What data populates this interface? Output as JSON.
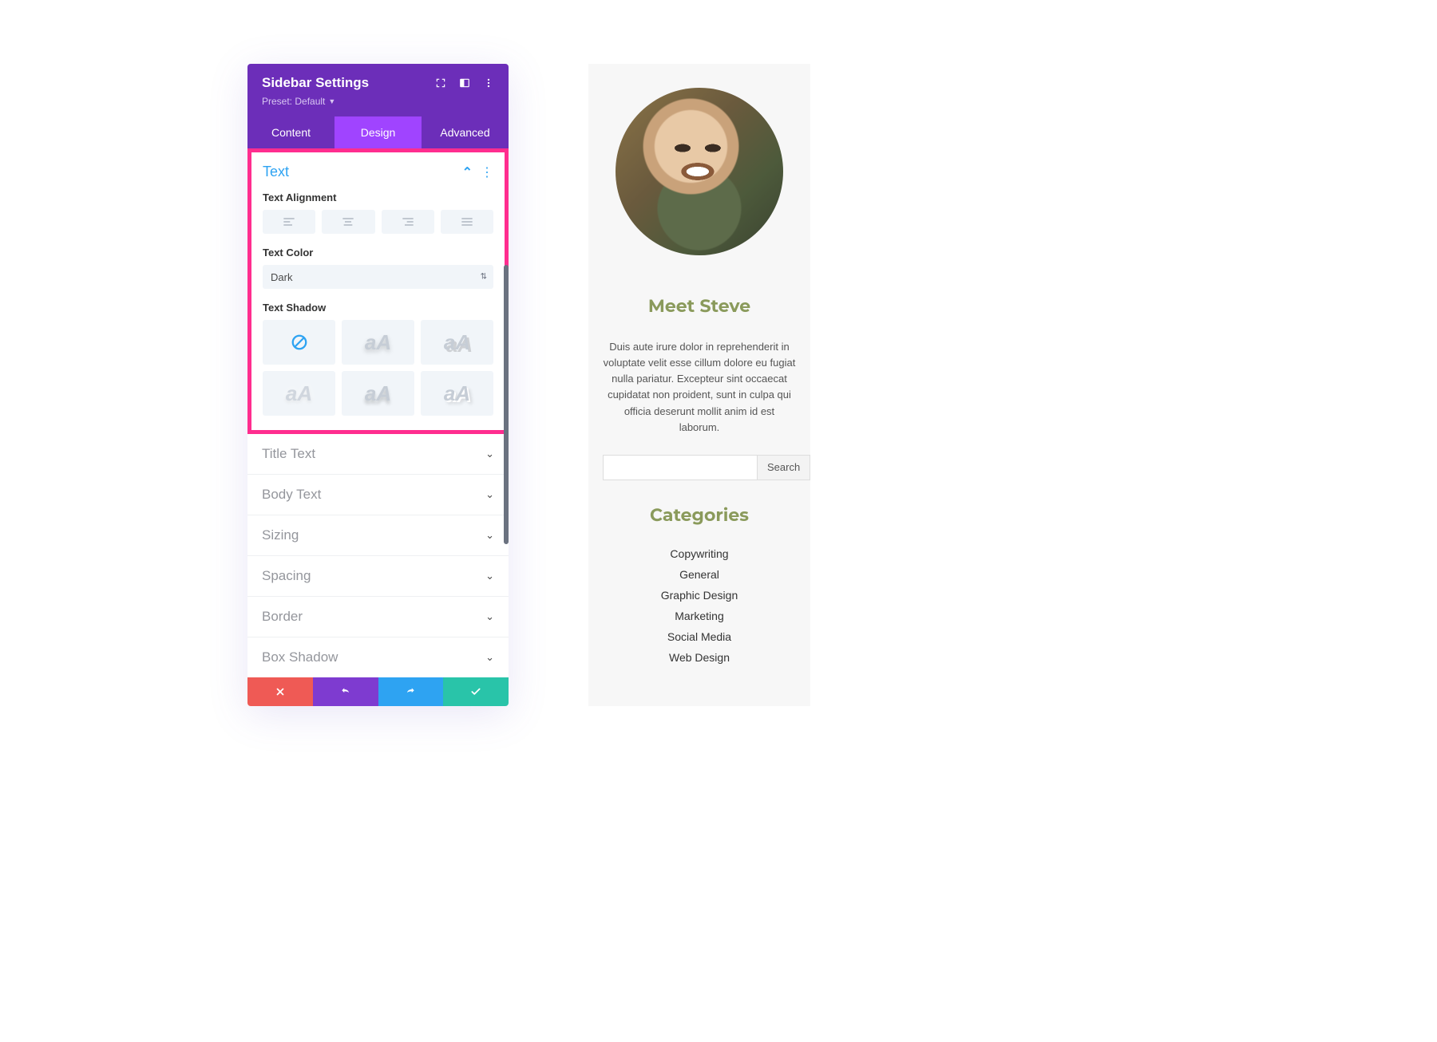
{
  "panel": {
    "title": "Sidebar Settings",
    "preset_label": "Preset: Default",
    "tabs": [
      "Content",
      "Design",
      "Advanced"
    ],
    "active_tab": 1,
    "text_section": {
      "title": "Text",
      "alignment_label": "Text Alignment",
      "color_label": "Text Color",
      "color_value": "Dark",
      "shadow_label": "Text Shadow",
      "shadow_sample": "aA"
    },
    "accordion": [
      "Title Text",
      "Body Text",
      "Sizing",
      "Spacing",
      "Border",
      "Box Shadow"
    ]
  },
  "preview": {
    "meet_title": "Meet Steve",
    "meet_text": "Duis aute irure dolor in reprehenderit in voluptate velit esse cillum dolore eu fugiat nulla pariatur. Excepteur sint occaecat cupidatat non proident, sunt in culpa qui officia deserunt mollit anim id est laborum.",
    "search_button": "Search",
    "categories_title": "Categories",
    "categories": [
      "Copywriting",
      "General",
      "Graphic Design",
      "Marketing",
      "Social Media",
      "Web Design"
    ]
  }
}
